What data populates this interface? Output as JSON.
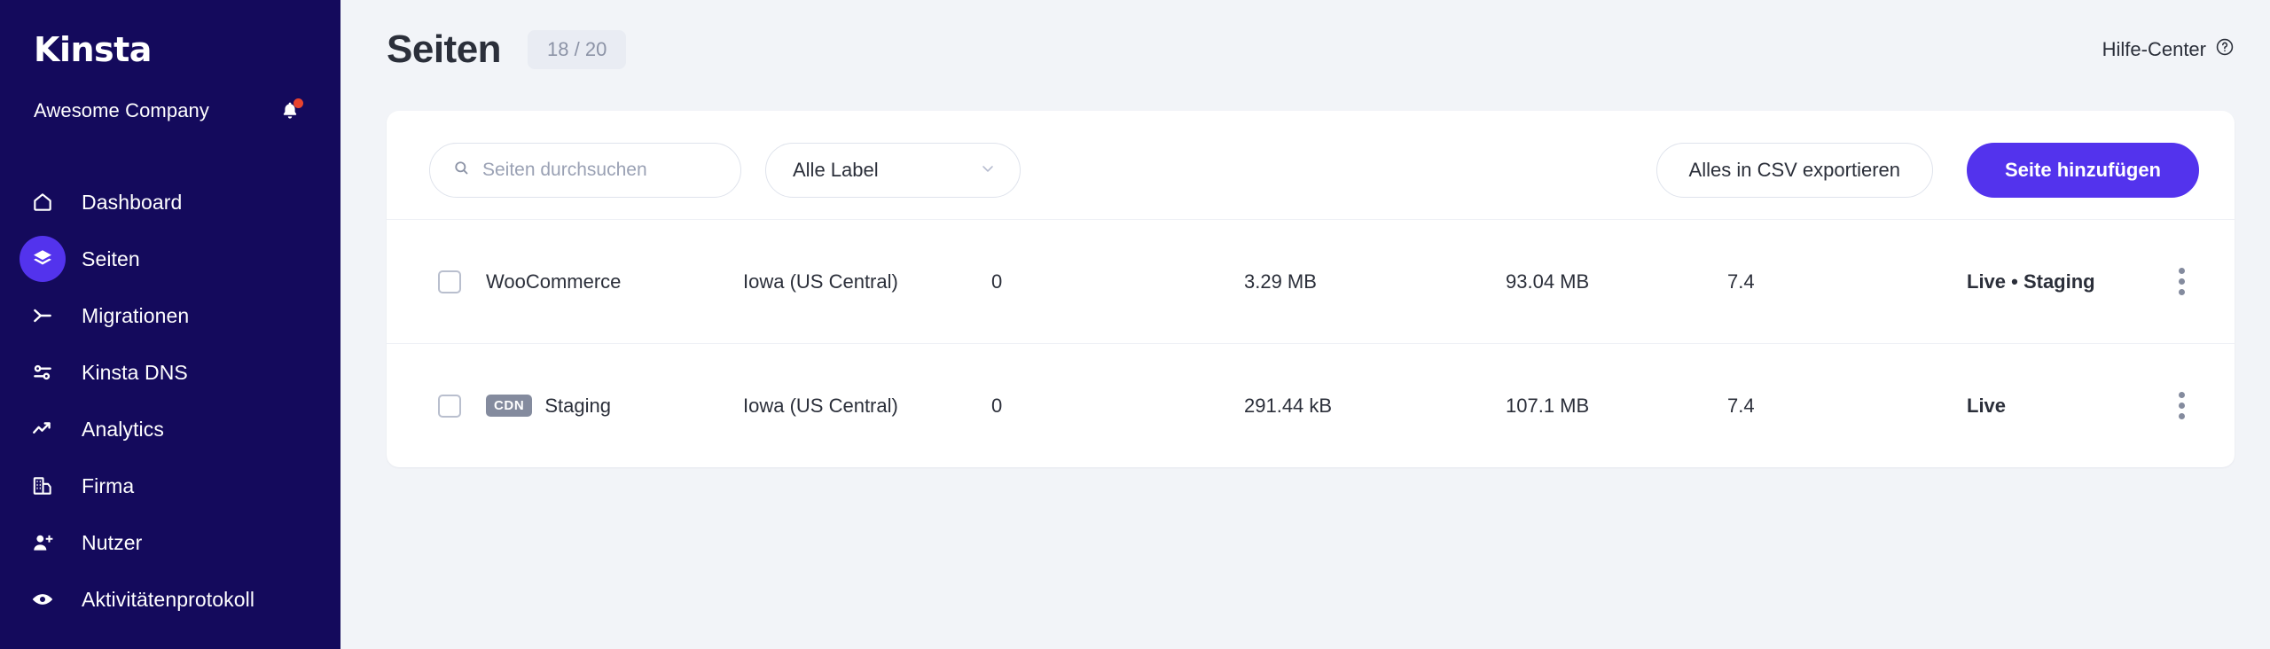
{
  "sidebar": {
    "logo_text": "Kinsta",
    "company_name": "Awesome Company",
    "notification_icon": "bell-icon",
    "items": [
      {
        "label": "Dashboard",
        "icon": "home-icon",
        "active": false
      },
      {
        "label": "Seiten",
        "icon": "layers-icon",
        "active": true
      },
      {
        "label": "Migrationen",
        "icon": "migration-fork-icon",
        "active": false
      },
      {
        "label": "Kinsta DNS",
        "icon": "dns-nodes-icon",
        "active": false
      },
      {
        "label": "Analytics",
        "icon": "trending-up-icon",
        "active": false
      },
      {
        "label": "Firma",
        "icon": "building-icon",
        "active": false
      },
      {
        "label": "Nutzer",
        "icon": "user-plus-icon",
        "active": false
      },
      {
        "label": "Aktivitätenprotokoll",
        "icon": "eye-icon",
        "active": false
      }
    ]
  },
  "header": {
    "title": "Seiten",
    "count_badge": "18 / 20",
    "help_label": "Hilfe-Center",
    "help_icon": "question-circle-icon"
  },
  "toolbar": {
    "search_placeholder": "Seiten durchsuchen",
    "search_value": "",
    "search_icon": "search-icon",
    "label_filter_value": "Alle Label",
    "label_filter_icon": "chevron-down-icon",
    "export_csv_label": "Alles in CSV exportieren",
    "add_site_label": "Seite hinzufügen"
  },
  "table": {
    "rows": [
      {
        "selected": false,
        "badge": "",
        "name": "WooCommerce",
        "region": "Iowa (US Central)",
        "visits": "0",
        "size": "3.29 MB",
        "disk": "93.04 MB",
        "php": "7.4",
        "environments": "Live • Staging",
        "menu_icon": "kebab-menu-icon"
      },
      {
        "selected": false,
        "badge": "CDN",
        "name": "Staging",
        "region": "Iowa (US Central)",
        "visits": "0",
        "size": "291.44 kB",
        "disk": "107.1 MB",
        "php": "7.4",
        "environments": "Live",
        "menu_icon": "kebab-menu-icon"
      }
    ]
  },
  "colors": {
    "sidebar_bg": "#140a5c",
    "accent": "#5333ed",
    "page_bg": "#f2f4f8",
    "card_bg": "#ffffff",
    "text": "#2b2f3a",
    "muted": "#8c93a6",
    "badge_gray": "#848b9e",
    "notification_red": "#e8432e"
  }
}
